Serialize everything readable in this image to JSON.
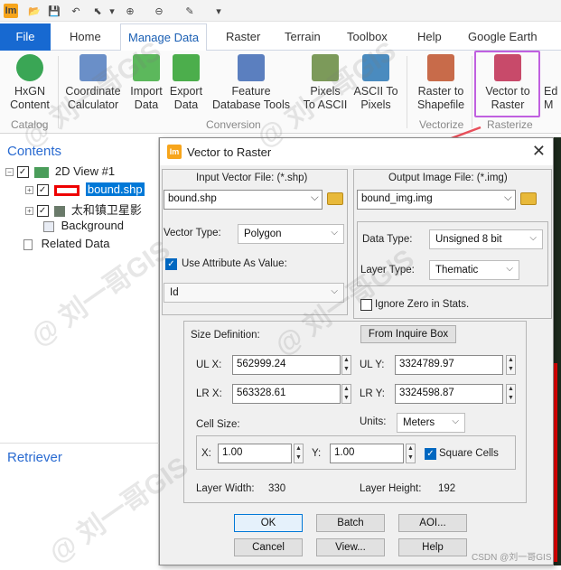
{
  "qat": {
    "icons": [
      "app-logo-icon",
      "open-icon",
      "save-icon",
      "undo-icon",
      "select-arrow-icon",
      "dropdown-icon",
      "zoom-in-icon",
      "zoom-out-icon",
      "eraser-icon",
      "customize-icon"
    ],
    "logo": "Im"
  },
  "tabs": [
    "File",
    "Home",
    "Manage Data",
    "Raster",
    "Terrain",
    "Toolbox",
    "Help",
    "Google Earth"
  ],
  "ribbon": {
    "buttons": [
      {
        "l1": "HxGN",
        "l2": "Content"
      },
      {
        "l1": "Coordinate",
        "l2": "Calculator"
      },
      {
        "l1": "Import",
        "l2": "Data"
      },
      {
        "l1": "Export",
        "l2": "Data"
      },
      {
        "l1": "Feature",
        "l2": "Database Tools"
      },
      {
        "l1": "Pixels",
        "l2": "To ASCII"
      },
      {
        "l1": "ASCII To",
        "l2": "Pixels"
      },
      {
        "l1": "Raster to",
        "l2": "Shapefile"
      },
      {
        "l1": "Vector to",
        "l2": "Raster"
      },
      {
        "l1": "Ed",
        "l2": "M"
      }
    ],
    "groups": [
      "Catalog",
      "Conversion",
      "Vectorize",
      "Rasterize"
    ]
  },
  "contents": {
    "title": "Contents",
    "view": "2D View #1",
    "layer1": "bound.shp",
    "layer2": "太和镇卫星影",
    "background": "Background",
    "related": "Related Data"
  },
  "retriever": "Retriever",
  "dialog": {
    "logo": "Im",
    "title": "Vector to Raster",
    "close": "✕",
    "input_label": "Input Vector File: (*.shp)",
    "input_value": "bound.shp",
    "output_label": "Output Image File: (*.img)",
    "output_value": "bound_img.img",
    "vector_type_label": "Vector Type:",
    "vector_type": "Polygon",
    "use_attr_label": "Use Attribute As Value:",
    "attr_value": "Id",
    "data_type_label": "Data Type:",
    "data_type": "Unsigned 8 bit",
    "layer_type_label": "Layer Type:",
    "layer_type": "Thematic",
    "ignore_zero_label": "Ignore Zero in Stats.",
    "size_def_label": "Size Definition:",
    "inquire_btn": "From Inquire Box",
    "ulx_label": "UL X:",
    "ulx": "562999.24",
    "uly_label": "UL Y:",
    "uly": "3324789.97",
    "lrx_label": "LR X:",
    "lrx": "563328.61",
    "lry_label": "LR Y:",
    "lry": "3324598.87",
    "cell_size_label": "Cell Size:",
    "units_label": "Units:",
    "units": "Meters",
    "x_label": "X:",
    "x": "1.00",
    "y_label": "Y:",
    "y": "1.00",
    "square_label": "Square Cells",
    "lw_label": "Layer Width:",
    "lw": "330",
    "lh_label": "Layer Height:",
    "lh": "192",
    "ok": "OK",
    "batch": "Batch",
    "aoi": "AOI...",
    "cancel": "Cancel",
    "view": "View...",
    "help": "Help"
  },
  "watermark": "@ 刘一哥GIS",
  "credit": "CSDN @刘一哥GIS",
  "colors": {
    "accent": "#1769d1",
    "highlight": "#c060e0",
    "arrow": "#e8505b",
    "selection": "#0078d7"
  }
}
